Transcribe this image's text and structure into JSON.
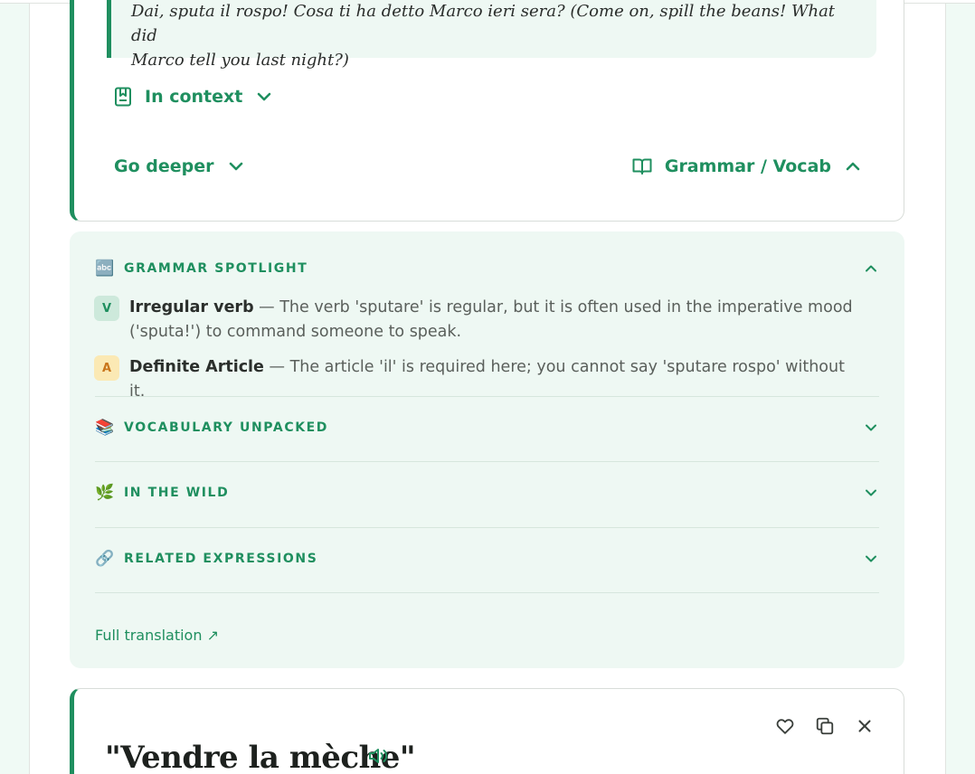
{
  "example": {
    "quote_line1": "Dai, sputa il rospo! Cosa ti ha detto Marco ieri sera? (Come on, spill the beans! What did",
    "quote_line2": "Marco tell you last night?)"
  },
  "card_controls": {
    "in_context_label": "In context",
    "go_deeper_label": "Go deeper",
    "grammar_vocab_label": "Grammar / Vocab"
  },
  "panel": {
    "sections": [
      {
        "emoji": "🔤",
        "title": "GRAMMAR SPOTLIGHT",
        "expanded": true
      },
      {
        "emoji": "📚",
        "title": "VOCABULARY UNPACKED",
        "expanded": false
      },
      {
        "emoji": "🌿",
        "title": "IN THE WILD",
        "expanded": false
      },
      {
        "emoji": "🔗",
        "title": "RELATED EXPRESSIONS",
        "expanded": false
      }
    ],
    "grammar_items": [
      {
        "badge": "V",
        "term": "Irregular verb",
        "text": " — The verb 'sputare' is regular, but it is often used in the imperative mood ('sputa!') to command someone to speak."
      },
      {
        "badge": "A",
        "term": "Definite Article",
        "text": " — The article 'il' is required here; you cannot say 'sputare rospo' without it."
      }
    ],
    "full_translation_label": "Full translation ↗"
  },
  "next_card": {
    "title": "\"Vendre la mèche\""
  },
  "icons": {
    "in_context": "bookmark-icon",
    "grammar_vocab": "open-book-icon",
    "speaker": "speaker-icon",
    "favorite": "heart-icon",
    "copy": "copy-icon",
    "close": "close-icon"
  },
  "colors": {
    "accent": "#1f8f5f",
    "panel_bg": "#eef8f3",
    "page_bg": "#f0faf5",
    "badge_verb": "#cde9db",
    "badge_article": "#fbe9b4"
  }
}
